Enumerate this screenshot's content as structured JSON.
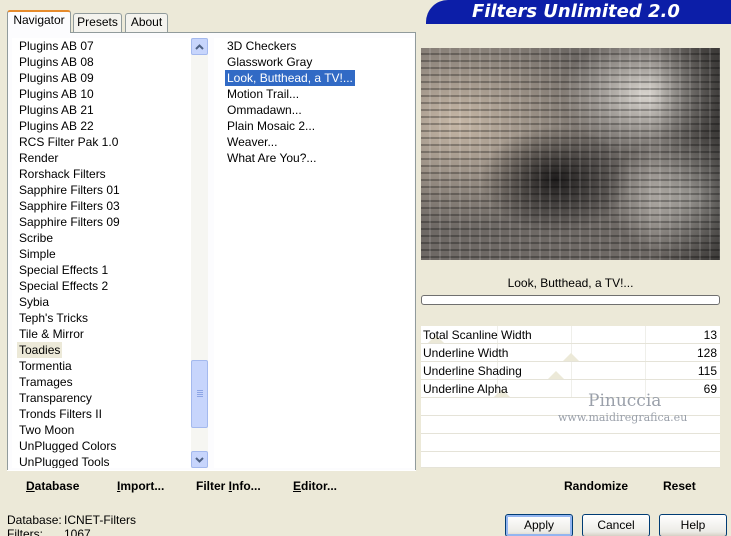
{
  "tabs": [
    "Navigator",
    "Presets",
    "About"
  ],
  "banner_title": "Filters Unlimited 2.0",
  "categories": [
    "Plugins AB 07",
    "Plugins AB 08",
    "Plugins AB 09",
    "Plugins AB 10",
    "Plugins AB 21",
    "Plugins AB 22",
    "RCS Filter Pak 1.0",
    "Render",
    "Rorshack Filters",
    "Sapphire Filters 01",
    "Sapphire Filters 03",
    "Sapphire Filters 09",
    "Scribe",
    "Simple",
    "Special Effects 1",
    "Special Effects 2",
    "Sybia",
    "Teph's Tricks",
    "Tile & Mirror",
    "Toadies",
    "Tormentia",
    "Tramages",
    "Transparency",
    "Tronds Filters II",
    "Two Moon",
    "UnPlugged Colors",
    "UnPlugged Tools"
  ],
  "selected_category": "Toadies",
  "filters": [
    "3D Checkers",
    "Glasswork Gray",
    "Look, Butthead, a TV!...",
    "Motion Trail...",
    "Ommadawn...",
    "Plain Mosaic 2...",
    "Weaver...",
    "What Are You?..."
  ],
  "selected_filter": "Look, Butthead, a TV!...",
  "filter_name_display": "Look, Butthead, a TV!...",
  "params": [
    {
      "label": "Total Scanline Width",
      "value": "13",
      "level": 13
    },
    {
      "label": "Underline Width",
      "value": "128",
      "level": 128
    },
    {
      "label": "Underline Shading",
      "value": "115",
      "level": 115
    },
    {
      "label": "Underline Alpha",
      "value": "69",
      "level": 69
    }
  ],
  "watermark": {
    "name": "Pinuccia",
    "site": "www.maidiregrafica.eu"
  },
  "toolbar": {
    "database": {
      "pre": "",
      "key": "D",
      "post": "atabase"
    },
    "import": {
      "pre": "",
      "key": "I",
      "post": "mport..."
    },
    "filter_info": {
      "pre": "Filter ",
      "key": "I",
      "post": "nfo..."
    },
    "editor": {
      "pre": "",
      "key": "E",
      "post": "ditor..."
    },
    "randomize": "Randomize",
    "reset": "Reset"
  },
  "status": {
    "database_label": "Database:",
    "database_value": "ICNET-Filters",
    "filters_label": "Filters:",
    "filters_value": "1067"
  },
  "buttons": {
    "apply": "Apply",
    "cancel": "Cancel",
    "help": "Help"
  },
  "colors": {
    "selection": "#316AC5",
    "banner": "#0C1EA8",
    "face": "#ECE9D8",
    "tab_accent": "#E68B2C"
  }
}
